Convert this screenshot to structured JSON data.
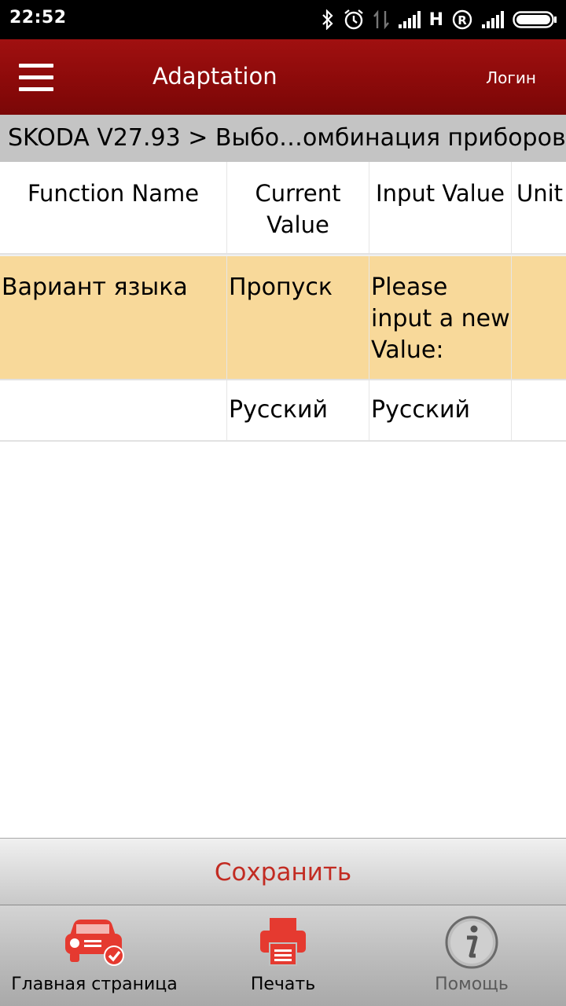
{
  "status_bar": {
    "time": "22:52",
    "network_label": "H",
    "icons": [
      "bluetooth-icon",
      "alarm-icon",
      "data-arrows-icon",
      "signal-icon",
      "roaming-icon",
      "signal-icon",
      "battery-icon"
    ]
  },
  "header": {
    "title": "Adaptation",
    "login_label": "Логин",
    "menu_icon": "hamburger-menu-icon",
    "background_color": "#8c0a0a"
  },
  "breadcrumb": {
    "text": "SKODA V27.93 > Выбо…омбинация приборов"
  },
  "table": {
    "columns": [
      "Function Name",
      "Current\nValue",
      "Input Value",
      "Unit"
    ],
    "rows": [
      {
        "function_name": "Вариант языка",
        "current_value": "Пропуск",
        "input_value": "Please input a new Value:",
        "unit": "",
        "highlight_color": "#f8d99a"
      },
      {
        "function_name": "",
        "current_value": "Русский",
        "input_value": "Русский",
        "unit": ""
      }
    ]
  },
  "save_button": {
    "label": "Сохранить",
    "text_color": "#c22b22"
  },
  "bottom_nav": {
    "items": [
      {
        "label": "Главная страница",
        "icon": "car-check-icon"
      },
      {
        "label": "Печать",
        "icon": "printer-icon"
      },
      {
        "label": "Помощь",
        "icon": "info-icon"
      }
    ],
    "accent_color": "#e53a30"
  }
}
